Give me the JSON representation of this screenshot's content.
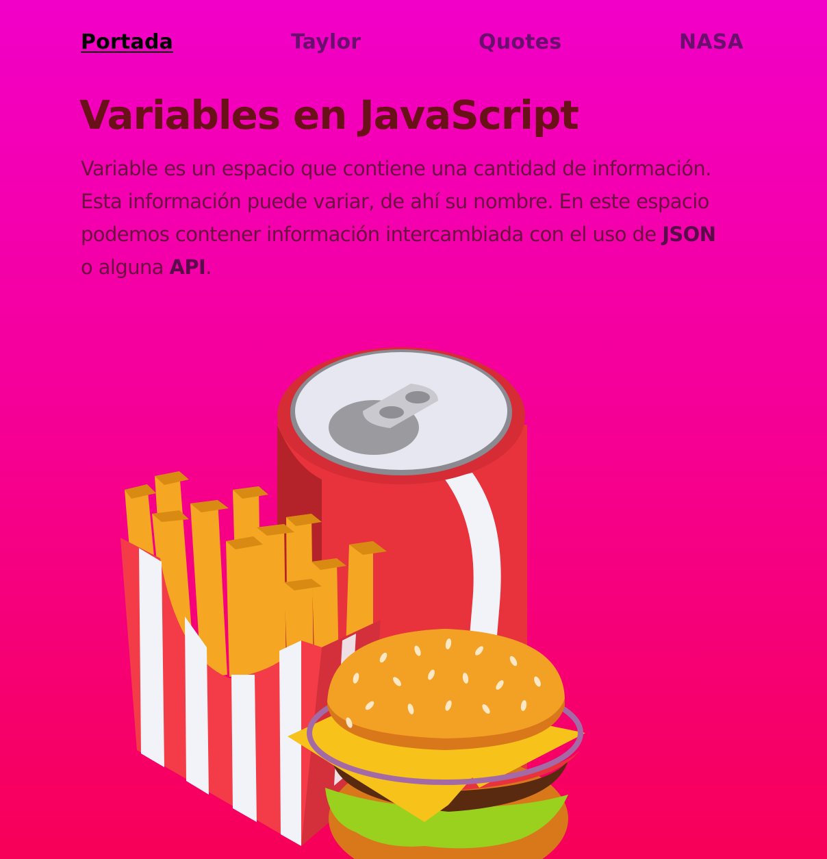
{
  "nav": {
    "items": [
      {
        "label": "Portada",
        "active": true
      },
      {
        "label": "Taylor",
        "active": false
      },
      {
        "label": "Quotes",
        "active": false
      },
      {
        "label": "NASA",
        "active": false
      }
    ]
  },
  "main": {
    "title": "Variables en JavaScript",
    "intro_before_json": "Variable es un espacio que contiene una cantidad de información. Esta información puede variar, de ahí su nombre. En este espacio podemos contener información intercambiada con el uso de ",
    "json_term": "JSON",
    "intro_between": " o alguna ",
    "api_term": "API",
    "intro_end": "."
  },
  "illustration": {
    "icons": [
      "soda-can-icon",
      "french-fries-icon",
      "hamburger-icon"
    ]
  },
  "colors": {
    "background_top": "#f200c8",
    "background_bottom": "#f70058",
    "nav_text": "#6a0f6e",
    "title": "#6a1018"
  }
}
